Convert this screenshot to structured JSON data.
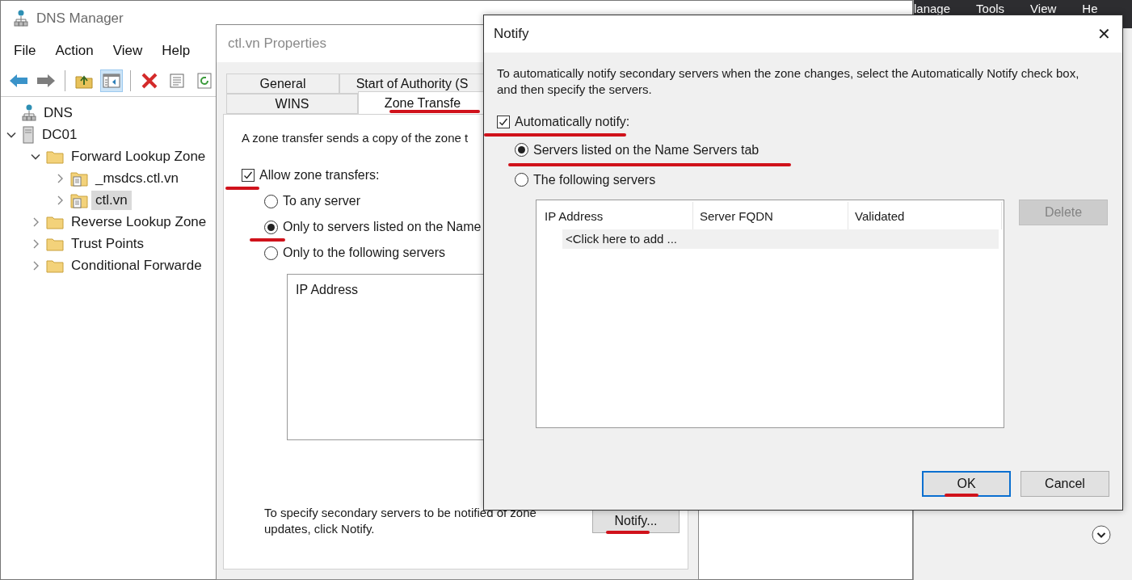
{
  "background_window": {
    "menu": [
      "lanage",
      "Tools",
      "View",
      "He"
    ]
  },
  "dns_manager": {
    "title": "DNS Manager",
    "menu": [
      "File",
      "Action",
      "View",
      "Help"
    ],
    "toolbar": [
      [
        {
          "kind": "back",
          "selected": false
        },
        {
          "kind": "forward",
          "selected": false
        }
      ],
      [
        {
          "kind": "up",
          "selected": false
        },
        {
          "kind": "console",
          "selected": true
        }
      ],
      [
        {
          "kind": "delete",
          "selected": false
        },
        {
          "kind": "properties",
          "selected": false
        },
        {
          "kind": "refresh",
          "selected": false
        }
      ]
    ],
    "tree": {
      "root": {
        "label": "DNS"
      },
      "items": [
        {
          "label": "DC01",
          "kind": "server",
          "expanded": true,
          "selected": false,
          "children": [
            {
              "label": "Forward Lookup Zone",
              "kind": "folder",
              "expanded": true,
              "selected": false,
              "children": [
                {
                  "label": "_msdcs.ctl.vn",
                  "kind": "zone",
                  "expanded": false,
                  "selected": false
                },
                {
                  "label": "ctl.vn",
                  "kind": "zone",
                  "expanded": false,
                  "selected": true
                }
              ]
            },
            {
              "label": "Reverse Lookup Zone",
              "kind": "folder",
              "expanded": false,
              "selected": false
            },
            {
              "label": "Trust Points",
              "kind": "folder",
              "expanded": false,
              "selected": false
            },
            {
              "label": "Conditional Forwarde",
              "kind": "folder",
              "expanded": false,
              "selected": false
            }
          ]
        }
      ]
    }
  },
  "properties": {
    "title": "ctl.vn Properties",
    "tab_rows": [
      [
        {
          "label": "General",
          "selected": false,
          "underlined": false
        },
        {
          "label": "Start of Authority (S",
          "selected": false,
          "underlined": false
        }
      ],
      [
        {
          "label": "WINS",
          "selected": false,
          "underlined": false
        },
        {
          "label": "Zone Transfe",
          "selected": true,
          "underlined": true
        }
      ]
    ],
    "description": "A zone transfer sends a copy of the zone t",
    "allow": {
      "label": "Allow zone transfers:",
      "checked": true,
      "underlined": true
    },
    "options": [
      {
        "label": "To any server",
        "selected": false,
        "underlined": false
      },
      {
        "label": "Only to servers listed on the Name",
        "selected": true,
        "underlined": true
      },
      {
        "label": "Only to the following servers",
        "selected": false,
        "underlined": false
      }
    ],
    "list_header": "IP Address",
    "footer": "To specify secondary servers to be notified of zone updates, click Notify.",
    "notify_button": {
      "label": "Notify...",
      "underlined": true
    }
  },
  "notify": {
    "title": "Notify",
    "close": "✕",
    "description": "To automatically notify secondary servers when the zone changes, select the Automatically Notify check box, and then specify the servers.",
    "auto_notify": {
      "label": "Automatically notify:",
      "checked": true,
      "underlined": true
    },
    "options": [
      {
        "label": "Servers listed on the Name Servers tab",
        "selected": true,
        "underlined": true
      },
      {
        "label": "The following servers",
        "selected": false,
        "underlined": false
      }
    ],
    "columns": [
      "IP Address",
      "Server FQDN",
      "Validated"
    ],
    "add_row": "<Click here to add ...",
    "delete_button": {
      "label": "Delete",
      "disabled": true
    },
    "buttons": [
      {
        "label": "OK",
        "default": true,
        "underlined": true
      },
      {
        "label": "Cancel",
        "default": false,
        "underlined": false
      }
    ]
  }
}
